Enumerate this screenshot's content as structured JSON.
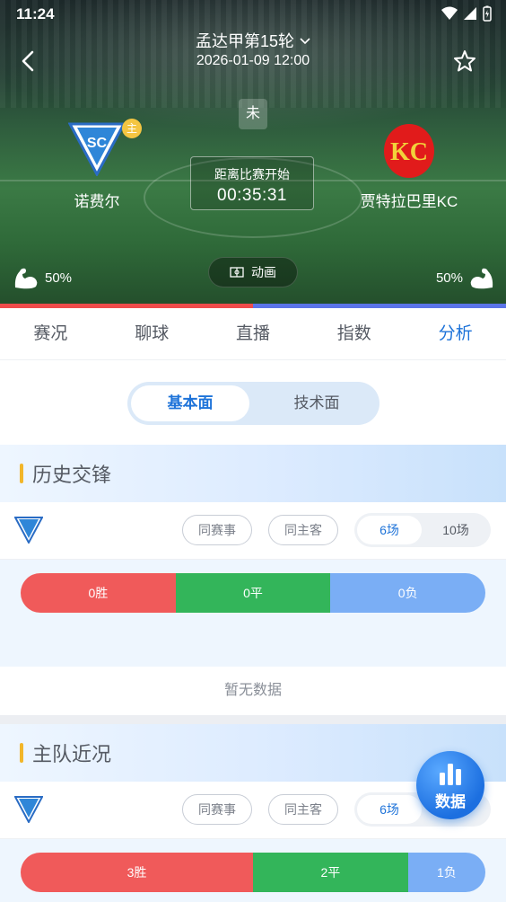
{
  "status_bar": {
    "time": "11:24"
  },
  "header": {
    "league_round": "孟达甲第15轮",
    "datetime": "2026-01-09 12:00",
    "match_state": "未"
  },
  "home_team": {
    "name": "诺费尔",
    "home_tag": "主",
    "logo_text": "SC",
    "strength": "50%"
  },
  "away_team": {
    "name": "贾特拉巴里KC",
    "logo_text": "KC",
    "strength": "50%"
  },
  "countdown": {
    "label": "距离比赛开始",
    "value": "00:35:31"
  },
  "animation_button": {
    "label": "动画"
  },
  "power_bar": {
    "home_fraction": 0.5,
    "home_color": "#ef4b4b",
    "away_color": "#5b74e8"
  },
  "tabs": [
    {
      "label": "赛况"
    },
    {
      "label": "聊球"
    },
    {
      "label": "直播"
    },
    {
      "label": "指数"
    },
    {
      "label": "分析"
    }
  ],
  "active_tab": "分析",
  "segment": {
    "basic": "基本面",
    "technical": "技术面"
  },
  "history": {
    "title": "历史交锋",
    "filters": {
      "same_event": "同赛事",
      "same_home_away": "同主客"
    },
    "counts": {
      "six": "6场",
      "ten": "10场"
    },
    "results": {
      "win": "0胜",
      "draw": "0平",
      "loss": "0负",
      "win_n": 0,
      "draw_n": 0,
      "loss_n": 0
    },
    "empty_text": "暂无数据"
  },
  "home_recent": {
    "title": "主队近况",
    "filters": {
      "same_event": "同赛事",
      "same_home_away": "同主客"
    },
    "counts": {
      "six": "6场",
      "ten": "10场"
    },
    "results": {
      "win": "3胜",
      "draw": "2平",
      "loss": "1负",
      "win_n": 3,
      "draw_n": 2,
      "loss_n": 1
    }
  },
  "fab": {
    "label": "数据"
  },
  "colors": {
    "accent": "#1e73d9",
    "win": "#f05a5a",
    "draw": "#33b55a",
    "loss": "#7aaef5",
    "section_bar": "#f2b62a"
  }
}
